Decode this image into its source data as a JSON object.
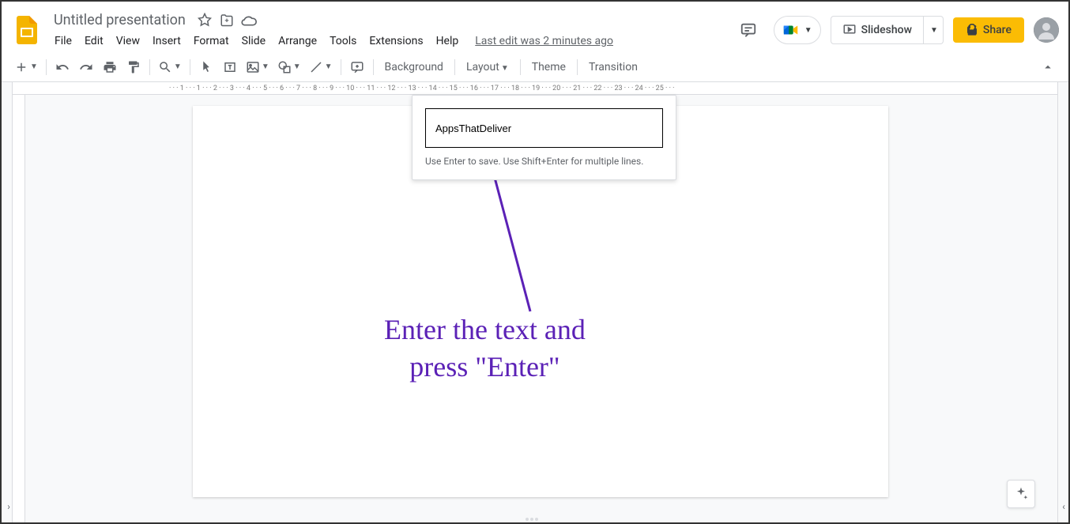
{
  "header": {
    "title": "Untitled presentation",
    "last_edit": "Last edit was 2 minutes ago"
  },
  "menubar": {
    "items": [
      "File",
      "Edit",
      "View",
      "Insert",
      "Format",
      "Slide",
      "Arrange",
      "Tools",
      "Extensions",
      "Help"
    ]
  },
  "toolbar": {
    "background": "Background",
    "layout": "Layout",
    "theme": "Theme",
    "transition": "Transition"
  },
  "actions": {
    "slideshow": "Slideshow",
    "share": "Share"
  },
  "ruler": {
    "marks": [
      "1",
      "1",
      "2",
      "3",
      "4",
      "5",
      "6",
      "7",
      "8",
      "9",
      "10",
      "11",
      "12",
      "13",
      "14",
      "15",
      "16",
      "17",
      "18",
      "19",
      "20",
      "21",
      "22",
      "23",
      "24",
      "25"
    ]
  },
  "comment": {
    "value": "AppsThatDeliver",
    "hint": "Use Enter to save. Use Shift+Enter for multiple lines."
  },
  "annotation": {
    "text": "Enter the text and\npress \"Enter\""
  }
}
